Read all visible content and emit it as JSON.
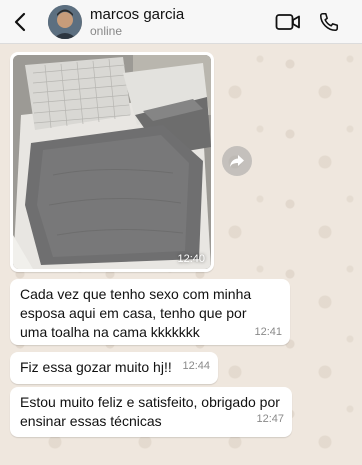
{
  "header": {
    "contact_name": "marcos garcia",
    "status": "online"
  },
  "icons": {
    "back": "chevron-left-icon",
    "video": "video-camera-icon",
    "call": "phone-icon",
    "forward": "forward-arrow-icon"
  },
  "messages": [
    {
      "type": "image",
      "time": "12:40"
    },
    {
      "type": "text",
      "text": "Cada vez que tenho sexo com minha esposa aqui em casa, tenho que por uma toalha na cama kkkkkkk",
      "time": "12:41"
    },
    {
      "type": "text",
      "text": "Fiz essa gozar muito hj!!",
      "time": "12:44"
    },
    {
      "type": "text",
      "text": "Estou muito feliz e satisfeito, obrigado por ensinar essas técnicas",
      "time": "12:47"
    }
  ],
  "colors": {
    "background": "#efe7de",
    "bubble": "#ffffff",
    "header": "#f7f7f7"
  }
}
